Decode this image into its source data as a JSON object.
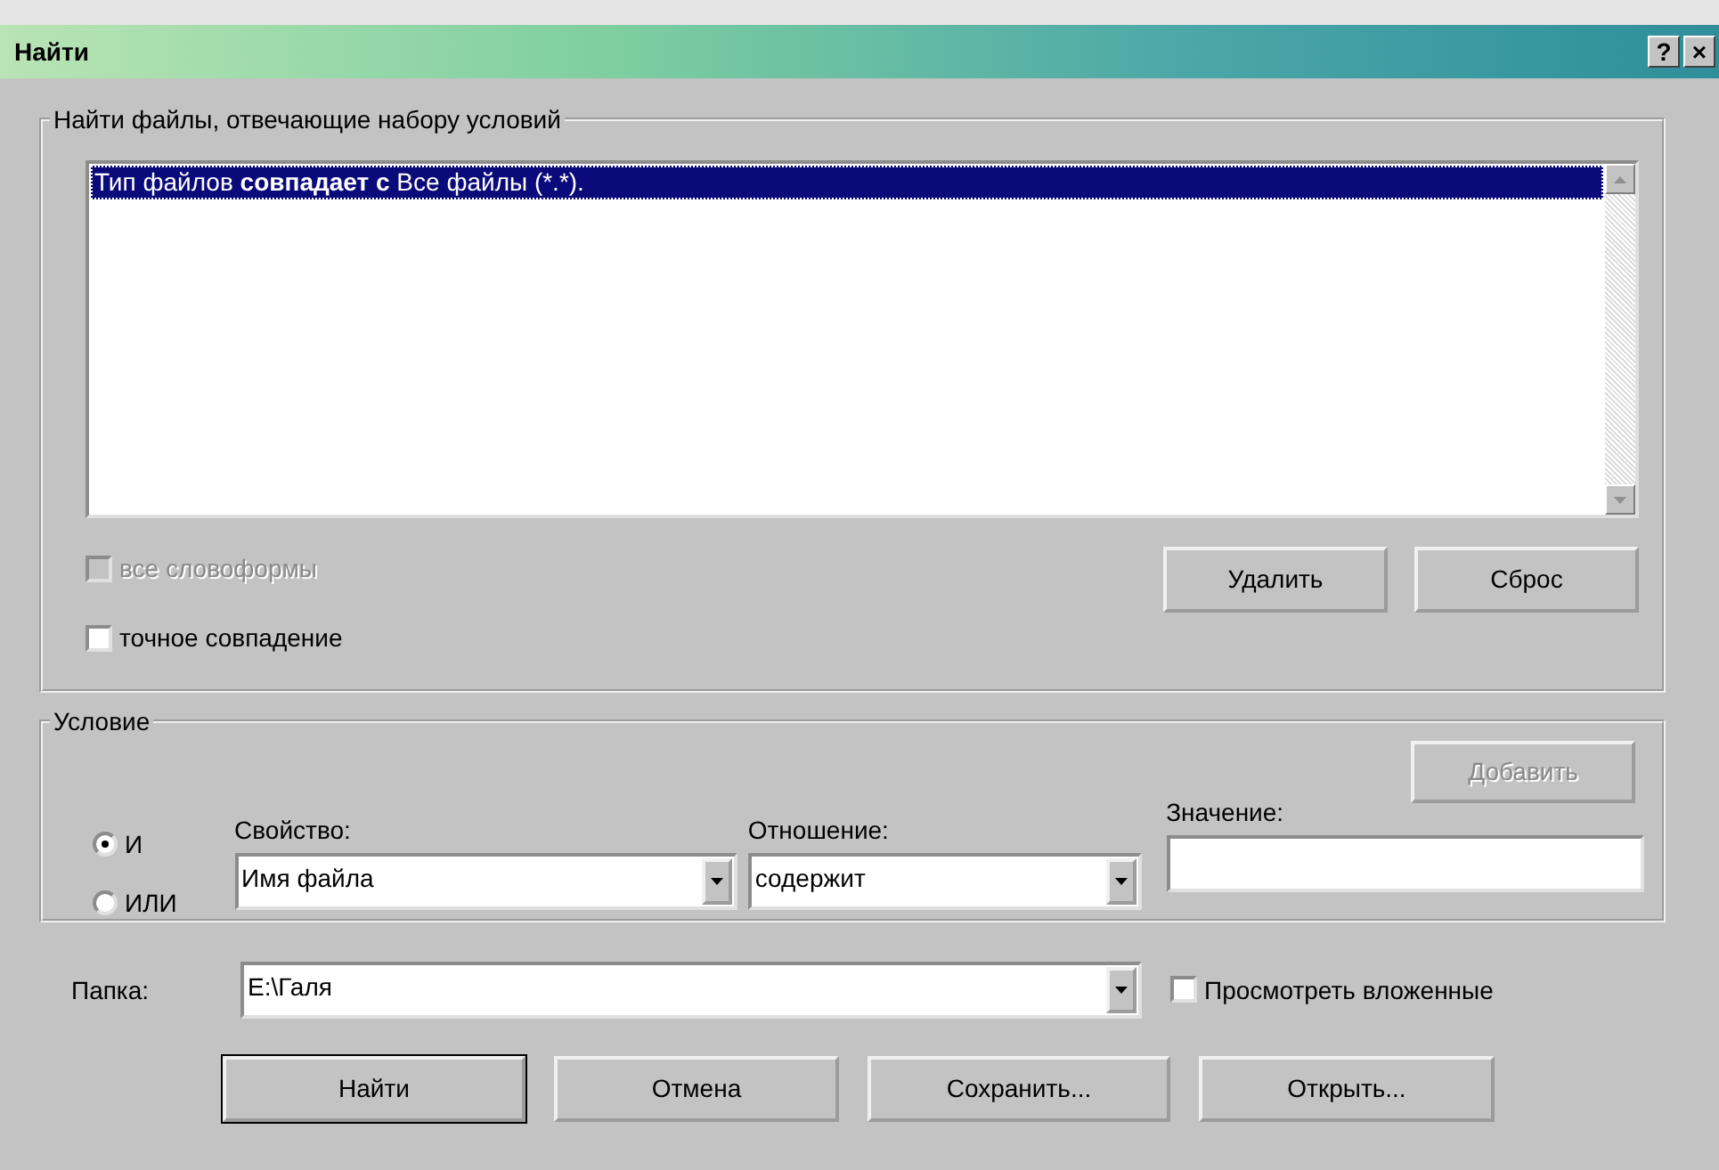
{
  "window": {
    "title": "Найти",
    "title_buttons": [
      "?",
      "×"
    ]
  },
  "criteria_group": {
    "legend": "Найти файлы, отвечающие набору условий",
    "rows": [
      {
        "parts": [
          {
            "kind": "plain",
            "text": "Тип файлов "
          },
          {
            "kind": "bold",
            "text": "совпадает с"
          },
          {
            "kind": "plain",
            "text": " Все файлы (*.*)."
          }
        ],
        "selected": true
      }
    ],
    "options": [
      {
        "label": "все словоформы",
        "checked": false,
        "disabled": true
      },
      {
        "label": "точное совпадение",
        "checked": false,
        "disabled": false
      }
    ],
    "buttons": [
      {
        "label": "Удалить",
        "disabled": false
      },
      {
        "label": "Сброс",
        "disabled": false
      }
    ]
  },
  "condition_group": {
    "legend": "Условие",
    "connectors": [
      {
        "label": "И",
        "selected": true
      },
      {
        "label": "ИЛИ",
        "selected": false
      }
    ],
    "add_button": {
      "label": "Добавить",
      "disabled": true
    },
    "property": {
      "label": "Свойство:",
      "value": "Имя файла"
    },
    "relation": {
      "label": "Отношение:",
      "value": "содержит"
    },
    "value_field": {
      "label": "Значение:"
    }
  },
  "folder": {
    "label": "Папка:",
    "value": "E:\\Галя"
  },
  "include_subfolders": {
    "label": "Просмотреть вложенные",
    "checked": false
  },
  "buttons": [
    {
      "label": "Найти",
      "default": true
    },
    {
      "label": "Отмена",
      "default": false
    },
    {
      "label": "Сохранить...",
      "default": false
    },
    {
      "label": "Открыть...",
      "default": false
    }
  ]
}
